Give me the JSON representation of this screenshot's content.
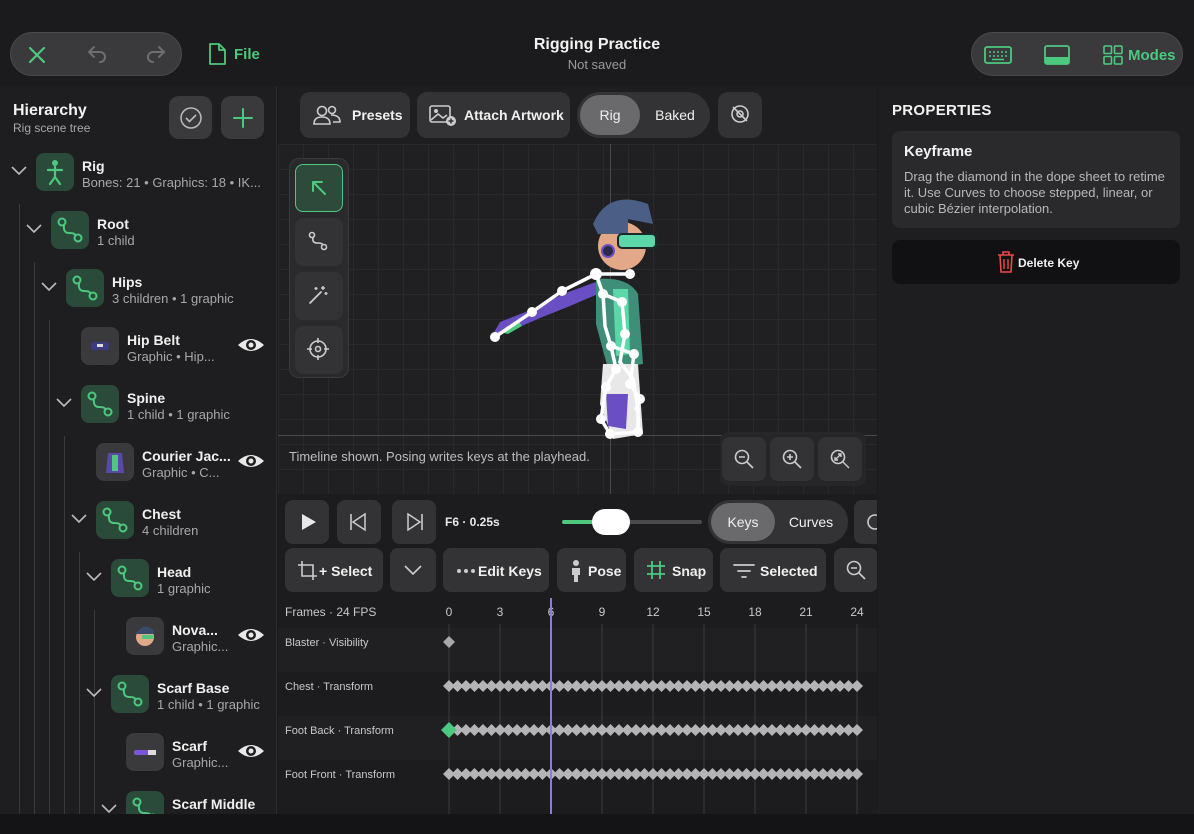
{
  "header": {
    "title": "Rigging Practice",
    "subtitle": "Not saved",
    "file_label": "File",
    "modes_label": "Modes"
  },
  "hierarchy": {
    "title": "Hierarchy",
    "subtitle": "Rig scene tree",
    "rows": [
      {
        "name": "Rig",
        "sub": "Bones: 21  •  Graphics: 18  •  IK..."
      },
      {
        "name": "Root",
        "sub": "1 child"
      },
      {
        "name": "Hips",
        "sub": "3 children  •  1 graphic"
      },
      {
        "name": "Hip Belt",
        "sub": "Graphic  •  Hip..."
      },
      {
        "name": "Spine",
        "sub": "1 child  •  1 graphic"
      },
      {
        "name": "Courier Jac...",
        "sub": "Graphic  •  C..."
      },
      {
        "name": "Chest",
        "sub": "4 children"
      },
      {
        "name": "Head",
        "sub": "1 graphic"
      },
      {
        "name": "Nova...",
        "sub": "Graphic..."
      },
      {
        "name": "Scarf Base",
        "sub": "1 child  •  1 graphic"
      },
      {
        "name": "Scarf",
        "sub": "Graphic..."
      },
      {
        "name": "Scarf Middle",
        "sub": ""
      }
    ]
  },
  "viewport": {
    "presets_label": "Presets",
    "attach_label": "Attach Artwork",
    "rig_label": "Rig",
    "baked_label": "Baked",
    "status": "Timeline shown. Posing writes keys at the playhead."
  },
  "timeline": {
    "frame_readout": "F6 · 0.25s",
    "keys_label": "Keys",
    "curves_label": "Curves",
    "select_label": "+ Select",
    "edit_keys_label": "Edit Keys",
    "pose_label": "Pose",
    "snap_label": "Snap",
    "selected_label": "Selected",
    "frames_label": "Frames · 24 FPS",
    "frame_ticks": [
      "0",
      "3",
      "6",
      "9",
      "12",
      "15",
      "18",
      "21",
      "24"
    ],
    "playhead_frame": 6,
    "speed_level": 0.33,
    "tracks": [
      {
        "label": "Blaster · Visibility"
      },
      {
        "label": "Chest · Transform"
      },
      {
        "label": "Foot Back · Transform"
      },
      {
        "label": "Foot Front · Transform"
      }
    ]
  },
  "properties": {
    "heading": "PROPERTIES",
    "card_title": "Keyframe",
    "card_text": "Drag the diamond in the dope sheet to retime it. Use Curves to choose stepped, linear, or cubic Bézier interpolation.",
    "delete_label": "Delete Key"
  },
  "colors": {
    "accent": "#4cc97f",
    "danger": "#e84a4a",
    "background": "#1e1e20"
  }
}
